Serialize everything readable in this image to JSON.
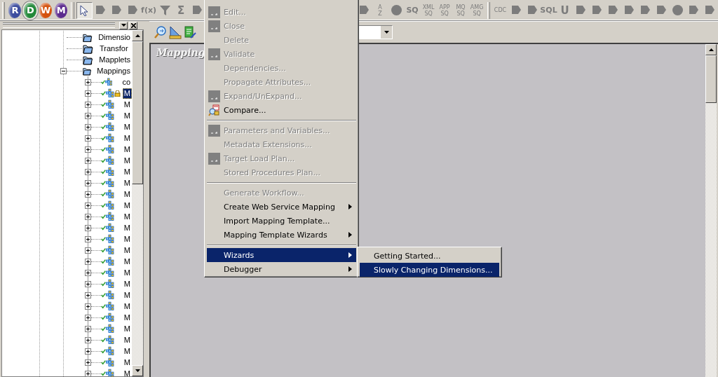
{
  "app_buttons": [
    {
      "label": "R",
      "color": "#3c4c9e",
      "selected": false
    },
    {
      "label": "D",
      "color": "#23893a",
      "selected": true
    },
    {
      "label": "W",
      "color": "#d4520e",
      "selected": false
    },
    {
      "label": "M",
      "color": "#5c2b8e",
      "selected": false
    }
  ],
  "tools_left": [
    {
      "kind": "pointer",
      "selected": true
    },
    {
      "kind": "block"
    },
    {
      "kind": "block"
    },
    {
      "kind": "block"
    },
    {
      "kind": "glyph",
      "text": "f(x)"
    },
    {
      "kind": "funnel"
    },
    {
      "kind": "glyph",
      "text": "Σ"
    },
    {
      "kind": "block"
    }
  ],
  "tools_right": [
    {
      "kind": "block"
    },
    {
      "kind": "stack",
      "top": "A",
      "bottom": "Z"
    },
    {
      "kind": "circle"
    },
    {
      "kind": "glyph",
      "text": "SQ"
    },
    {
      "kind": "stack",
      "top": "XML",
      "bottom": "SQ"
    },
    {
      "kind": "stack",
      "top": "APP",
      "bottom": "SQ"
    },
    {
      "kind": "stack",
      "top": "MQ",
      "bottom": "SQ"
    },
    {
      "kind": "stack",
      "top": "AMG",
      "bottom": "SQ"
    },
    {
      "kind": "grip"
    },
    {
      "kind": "stack",
      "top": "CDC"
    },
    {
      "kind": "block"
    },
    {
      "kind": "block"
    },
    {
      "kind": "glyph",
      "text": "SQL"
    },
    {
      "kind": "glyph",
      "text": "U"
    },
    {
      "kind": "block"
    },
    {
      "kind": "block"
    },
    {
      "kind": "block"
    },
    {
      "kind": "block"
    },
    {
      "kind": "block"
    },
    {
      "kind": "block"
    },
    {
      "kind": "circle"
    },
    {
      "kind": "block"
    },
    {
      "kind": "block"
    }
  ],
  "tree": [
    {
      "label": "Dimensio",
      "kind": "folder"
    },
    {
      "label": "Transfor",
      "kind": "folder"
    },
    {
      "label": "Mapplets",
      "kind": "folder"
    },
    {
      "label": "Mappings",
      "kind": "folder",
      "expanded": true,
      "children": [
        {
          "label": "co",
          "kind": "mapping",
          "expanded": false,
          "valid": true,
          "locked": false,
          "selected": false
        },
        {
          "label": "M",
          "kind": "mapping",
          "expanded": false,
          "valid": true,
          "locked": true,
          "selected": true
        },
        {
          "label": "M",
          "kind": "mapping",
          "expanded": false,
          "valid": true,
          "locked": false,
          "selected": false
        },
        {
          "label": "M",
          "kind": "mapping",
          "expanded": false,
          "valid": true,
          "locked": false,
          "selected": false
        },
        {
          "label": "M",
          "kind": "mapping",
          "expanded": false,
          "valid": true,
          "locked": false,
          "selected": false
        },
        {
          "label": "M",
          "kind": "mapping",
          "expanded": false,
          "valid": true,
          "locked": false,
          "selected": false
        },
        {
          "label": "M",
          "kind": "mapping",
          "expanded": false,
          "valid": true,
          "locked": false,
          "selected": false
        },
        {
          "label": "M",
          "kind": "mapping",
          "expanded": false,
          "valid": true,
          "locked": false,
          "selected": false
        },
        {
          "label": "M",
          "kind": "mapping",
          "expanded": false,
          "valid": true,
          "locked": false,
          "selected": false
        },
        {
          "label": "M",
          "kind": "mapping",
          "expanded": false,
          "valid": true,
          "locked": false,
          "selected": false
        },
        {
          "label": "M",
          "kind": "mapping",
          "expanded": false,
          "valid": true,
          "locked": false,
          "selected": false
        },
        {
          "label": "M",
          "kind": "mapping",
          "expanded": false,
          "valid": true,
          "locked": false,
          "selected": false
        },
        {
          "label": "M",
          "kind": "mapping",
          "expanded": false,
          "valid": true,
          "locked": false,
          "selected": false
        },
        {
          "label": "M",
          "kind": "mapping",
          "expanded": false,
          "valid": true,
          "locked": false,
          "selected": false
        },
        {
          "label": "M",
          "kind": "mapping",
          "expanded": false,
          "valid": true,
          "locked": false,
          "selected": false
        },
        {
          "label": "M",
          "kind": "mapping",
          "expanded": false,
          "valid": true,
          "locked": false,
          "selected": false
        },
        {
          "label": "M",
          "kind": "mapping",
          "expanded": false,
          "valid": true,
          "locked": false,
          "selected": false
        },
        {
          "label": "M",
          "kind": "mapping",
          "expanded": false,
          "valid": true,
          "locked": false,
          "selected": false
        },
        {
          "label": "M",
          "kind": "mapping",
          "expanded": false,
          "valid": true,
          "locked": false,
          "selected": false
        },
        {
          "label": "M",
          "kind": "mapping",
          "expanded": false,
          "valid": true,
          "locked": false,
          "selected": false
        },
        {
          "label": "M",
          "kind": "mapping",
          "expanded": false,
          "valid": true,
          "locked": false,
          "selected": false
        },
        {
          "label": "M",
          "kind": "mapping",
          "expanded": false,
          "valid": true,
          "locked": false,
          "selected": false
        },
        {
          "label": "M",
          "kind": "mapping",
          "expanded": false,
          "valid": true,
          "locked": false,
          "selected": false
        },
        {
          "label": "M",
          "kind": "mapping",
          "expanded": false,
          "valid": true,
          "locked": false,
          "selected": false
        },
        {
          "label": "M",
          "kind": "mapping",
          "expanded": false,
          "valid": true,
          "locked": false,
          "selected": false
        },
        {
          "label": "M",
          "kind": "mapping",
          "expanded": false,
          "valid": true,
          "locked": false,
          "selected": false
        },
        {
          "label": "M",
          "kind": "mapping",
          "expanded": false,
          "valid": true,
          "locked": false,
          "selected": false
        }
      ]
    }
  ],
  "canvas": {
    "label": "Mapping"
  },
  "context_menu": [
    {
      "kind": "gray",
      "label": "Edit...",
      "disabled": true,
      "selected": false,
      "submenu": false
    },
    {
      "kind": "gray",
      "label": "Close",
      "disabled": true,
      "selected": false,
      "submenu": false
    },
    {
      "kind": "plain",
      "label": "Delete",
      "disabled": true,
      "selected": false,
      "submenu": false
    },
    {
      "kind": "gray",
      "label": "Validate",
      "disabled": true,
      "selected": false,
      "submenu": false
    },
    {
      "kind": "plain",
      "label": "Dependencies...",
      "disabled": true,
      "selected": false,
      "submenu": false
    },
    {
      "kind": "plain",
      "label": "Propagate Attributes...",
      "disabled": true,
      "selected": false,
      "submenu": false
    },
    {
      "kind": "gray",
      "label": "Expand/UnExpand...",
      "disabled": true,
      "selected": false,
      "submenu": false
    },
    {
      "kind": "colored",
      "label": "Compare...",
      "disabled": false,
      "selected": false,
      "submenu": false
    },
    {
      "kind": "separator"
    },
    {
      "kind": "gray",
      "label": "Parameters and Variables...",
      "disabled": true,
      "selected": false,
      "submenu": false
    },
    {
      "kind": "plain",
      "label": "Metadata Extensions...",
      "disabled": true,
      "selected": false,
      "submenu": false
    },
    {
      "kind": "gray",
      "label": "Target Load Plan...",
      "disabled": true,
      "selected": false,
      "submenu": false
    },
    {
      "kind": "plain",
      "label": "Stored Procedures Plan...",
      "disabled": true,
      "selected": false,
      "submenu": false
    },
    {
      "kind": "separator"
    },
    {
      "kind": "plain",
      "label": "Generate Workflow...",
      "disabled": true,
      "selected": false,
      "submenu": false
    },
    {
      "kind": "plain",
      "label": "Create Web Service Mapping",
      "disabled": false,
      "selected": false,
      "submenu": true
    },
    {
      "kind": "plain",
      "label": "Import Mapping Template...",
      "disabled": false,
      "selected": false,
      "submenu": false
    },
    {
      "kind": "plain",
      "label": "Mapping Template Wizards",
      "disabled": false,
      "selected": false,
      "submenu": true
    },
    {
      "kind": "separator"
    },
    {
      "kind": "plain",
      "label": "Wizards",
      "disabled": false,
      "selected": true,
      "submenu": true
    },
    {
      "kind": "plain",
      "label": "Debugger",
      "disabled": false,
      "selected": false,
      "submenu": true
    }
  ],
  "submenu": [
    {
      "label": "Getting Started...",
      "selected": false
    },
    {
      "label": "Slowly Changing Dimensions...",
      "selected": true
    }
  ]
}
